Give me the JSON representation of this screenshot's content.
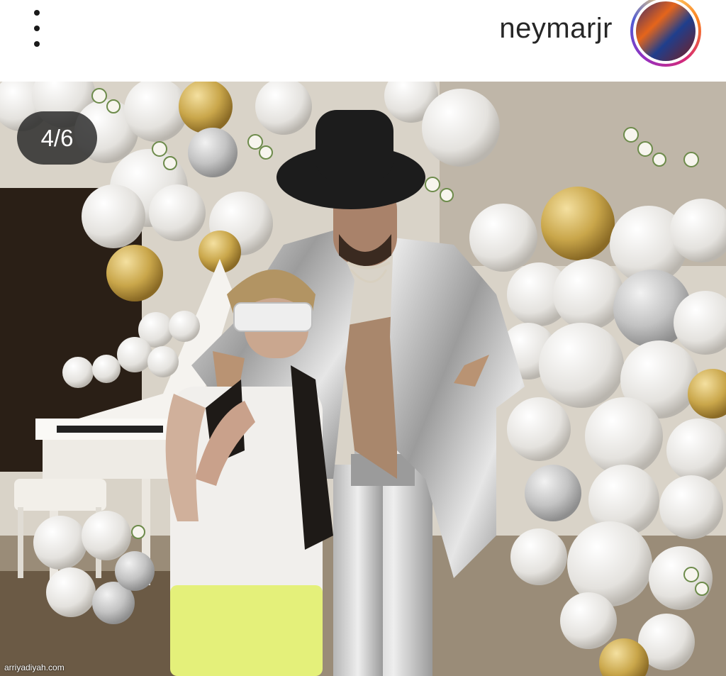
{
  "header": {
    "username": "neymarjr",
    "more_icon": "more-vertical-icon",
    "avatar": "profile-avatar"
  },
  "post": {
    "counter": "4/6",
    "watermark": "arriyadiyah.com"
  },
  "colors": {
    "header_bg": "#ffffff",
    "username": "#262626",
    "counter_bg": "#262626",
    "story_ring": [
      "#feda75",
      "#fa7e1e",
      "#d62976",
      "#962fbf",
      "#4f5bd5"
    ]
  }
}
